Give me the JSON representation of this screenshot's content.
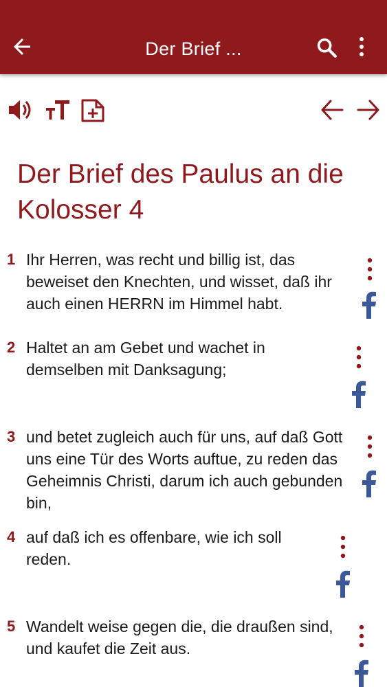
{
  "appbar": {
    "title": "Der Brief ...",
    "color": "#8e1a1e"
  },
  "toolbar": {
    "icons": [
      "speaker-icon",
      "text-size-icon",
      "add-note-icon",
      "arrow-left-icon",
      "arrow-right-icon"
    ]
  },
  "chapter": {
    "title": "Der Brief des Paulus an die Kolosser 4"
  },
  "verses": [
    {
      "num": "1",
      "text": "Ihr Herren, was recht und billig ist, das beweiset den Knechten, und wisset, daß ihr auch einen HERRN im Himmel habt."
    },
    {
      "num": "2",
      "text": "Haltet an am Gebet und wachet in demselben mit Danksagung;"
    },
    {
      "num": "3",
      "text": "und betet zugleich auch für uns, auf daß Gott uns eine Tür des Worts auftue, zu reden das Geheimnis Christi, darum ich auch gebunden bin,"
    },
    {
      "num": "4",
      "text": "auf daß ich es offenbare, wie ich soll reden."
    },
    {
      "num": "5",
      "text": "Wandelt weise gegen die, die draußen sind, und kaufet die Zeit aus."
    }
  ],
  "colors": {
    "accent": "#8e1a1e",
    "facebook": "#3b5998"
  }
}
